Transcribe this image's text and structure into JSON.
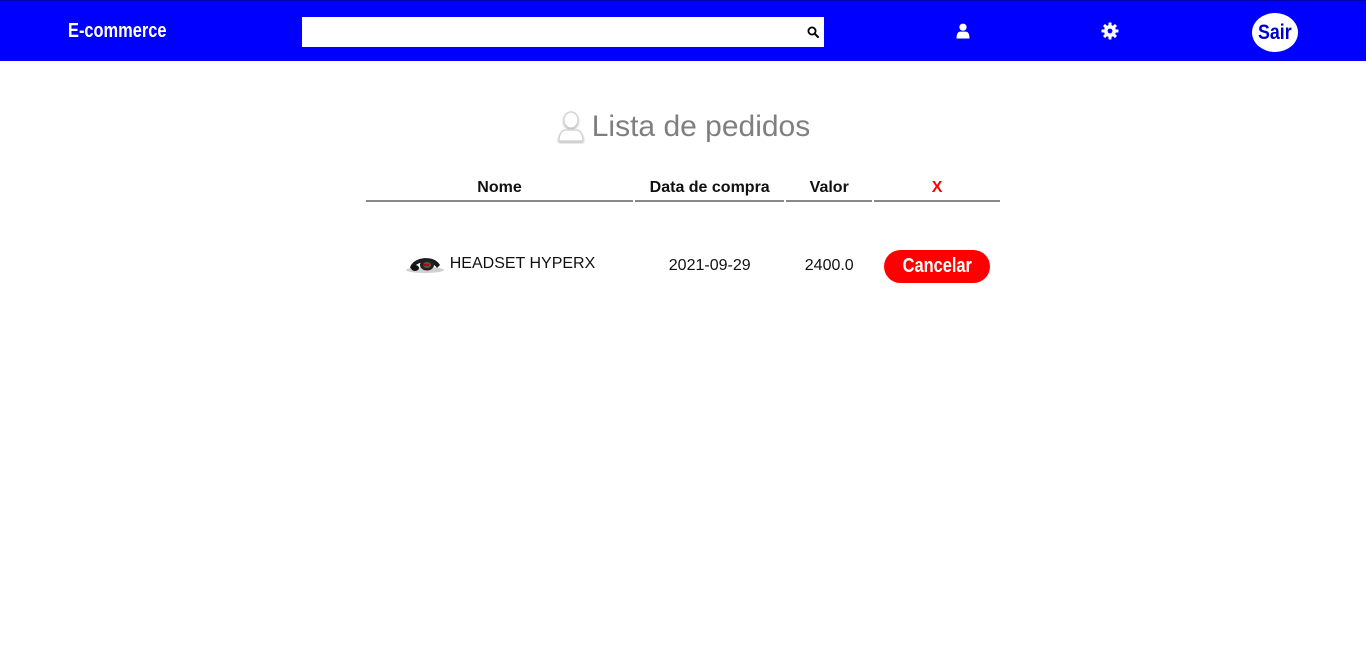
{
  "navbar": {
    "brand": "E-commerce",
    "search": {
      "value": "",
      "placeholder": "",
      "icon": "search-icon"
    },
    "user_icon": "user-icon",
    "settings_icon": "gear-icon",
    "logout_label": "Sair",
    "background_color": "#0000ff"
  },
  "page": {
    "title": "Lista de pedidos",
    "title_icon": "user-outline-icon",
    "title_color": "#7f7f7f"
  },
  "orders_table": {
    "headers": {
      "name": "Nome",
      "date": "Data de compra",
      "value": "Valor",
      "action": "X"
    },
    "rows": [
      {
        "name": "HEADSET HYPERX",
        "thumbnail": "headset-image",
        "date": "2021-09-29",
        "value": "2400.0",
        "action_label": "Cancelar"
      }
    ],
    "action_color": "#ff0000"
  }
}
